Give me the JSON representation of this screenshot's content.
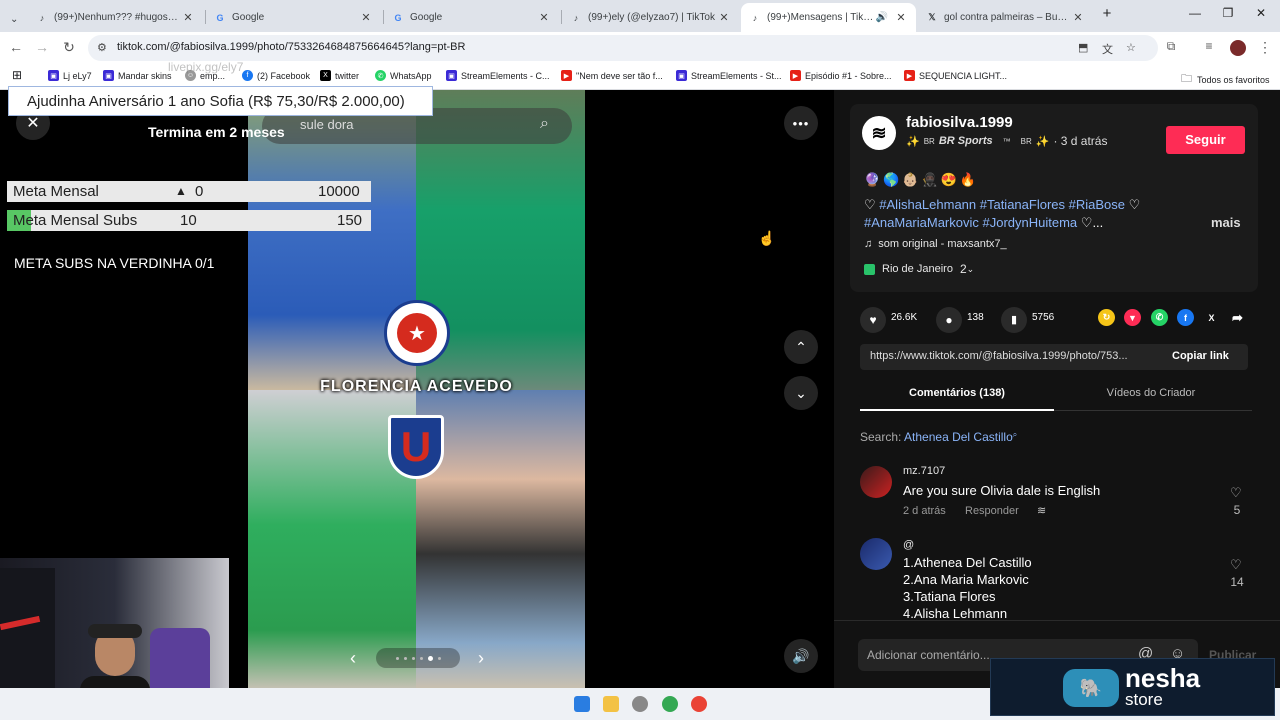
{
  "browser": {
    "tabs": [
      {
        "title": "(99+)Nenhum??? #hugosouza",
        "icon": "tiktok-icon"
      },
      {
        "title": "Google",
        "icon": "google-icon"
      },
      {
        "title": "Google",
        "icon": "google-icon"
      },
      {
        "title": "(99+)ely (@elyzao7) | TikTok",
        "icon": "tiktok-icon"
      },
      {
        "title": "(99+)Mensagens | TikTok",
        "icon": "tiktok-icon",
        "active": true
      },
      {
        "title": "gol contra palmeiras – Buscar",
        "icon": "x-icon"
      }
    ],
    "new_tab": "+",
    "url": "tiktok.com/@fabiosilva.1999/photo/7533264684875664645?lang=pt-BR",
    "bookmarks": [
      {
        "label": "Lj eLy7"
      },
      {
        "label": "Mandar skins"
      },
      {
        "label": "emp..."
      },
      {
        "label": "(2) Facebook"
      },
      {
        "label": "twitter"
      },
      {
        "label": "WhatsApp"
      },
      {
        "label": "StreamElements - C..."
      },
      {
        "label": "\"Nem deve ser tão f..."
      },
      {
        "label": "StreamElements - St..."
      },
      {
        "label": "Episódio #1 - Sobre..."
      },
      {
        "label": "SEQUENCIA LIGHT..."
      }
    ],
    "all_bookmarks": "Todos os favoritos"
  },
  "overlay": {
    "watermark": "livepix.gg/ely7",
    "banner": "Ajudinha Aniversário 1 ano Sofia (R$ 75,30/R$ 2.000,00)",
    "countdown": "Termina em 2 meses",
    "meta_mensal": {
      "label": "Meta Mensal",
      "current": "0",
      "target": "10000"
    },
    "meta_subs": {
      "label": "Meta Mensal Subs",
      "current": "10",
      "target": "150"
    },
    "verdinha": "META SUBS NA VERDINHA 0/1"
  },
  "viewer": {
    "search_partial": "sule dora",
    "photo_caption": "FLORENCIA ACEVEDO"
  },
  "post": {
    "author": "fabiosilva.1999",
    "subtitle_tag": "BR Sports",
    "subtitle_tm": "™",
    "subtitle_br": "BR",
    "time": "· 3 d atrás",
    "follow": "Seguir",
    "emojis": "🔮🌎👶🏼🥷🏿😍🔥",
    "hashtags_line1": "#AlishaLehmann #TatianaFlores #RiaBose",
    "hashtags_line2": "#AnaMariaMarkovic #JordynHuitema",
    "heart": "♡",
    "ellipsis": "...",
    "more": "mais",
    "music": "som original - maxsantx7_",
    "location": "Rio de Janeiro",
    "location_count": "2",
    "likes": "26.6K",
    "comments_count": "138",
    "saves": "5756",
    "link": "https://www.tiktok.com/@fabiosilva.1999/photo/753...",
    "copy_link": "Copiar link",
    "tab_comments": "Comentários (138)",
    "tab_videos": "Vídeos do Criador",
    "search_label": "Search:",
    "search_term": "Athenea Del Castillo"
  },
  "comments": [
    {
      "user": "mz.7107",
      "text": "Are you sure Olivia dale is English",
      "time": "2 d atrás",
      "reply": "Responder",
      "likes": "5"
    },
    {
      "user": "@",
      "lines": [
        "1.Athenea Del Castillo",
        "2.Ana Maria Markovic",
        "3.Tatiana Flores",
        "4.Alisha Lehmann"
      ],
      "likes": "14"
    }
  ],
  "composer": {
    "placeholder": "Adicionar comentário...",
    "publish": "Publicar"
  },
  "brand_overlay": {
    "name": "nesha",
    "sub": "store"
  },
  "colors": {
    "follow": "#fe2c55",
    "hashtag": "#8ab4f8",
    "panel": "#121212"
  }
}
